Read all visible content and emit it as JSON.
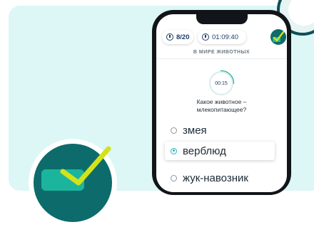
{
  "header": {
    "progress_text": "8/20",
    "timer_text": "01:09:40"
  },
  "quiz": {
    "category": "В МИРЕ ЖИВОТНЫХ",
    "countdown": "00:15",
    "question_line1": "Какое животное –",
    "question_line2": "млекопитающее?",
    "options": [
      {
        "label": "змея",
        "selected": false
      },
      {
        "label": "верблюд",
        "selected": true
      },
      {
        "label": "жук-навозник",
        "selected": false
      }
    ]
  },
  "colors": {
    "background_card": "#dcf7f5",
    "accent_teal": "#0d6b6b",
    "accent_green": "#1bb59e",
    "check_yellow": "#d4e21a",
    "radio_selected": "#29b3c6",
    "text_navy": "#1d3c66"
  },
  "icons": {
    "question": "question-circle-icon",
    "clock": "clock-icon",
    "logo": "checkmark-logo-icon",
    "badge": "checkmark-card-icon"
  }
}
